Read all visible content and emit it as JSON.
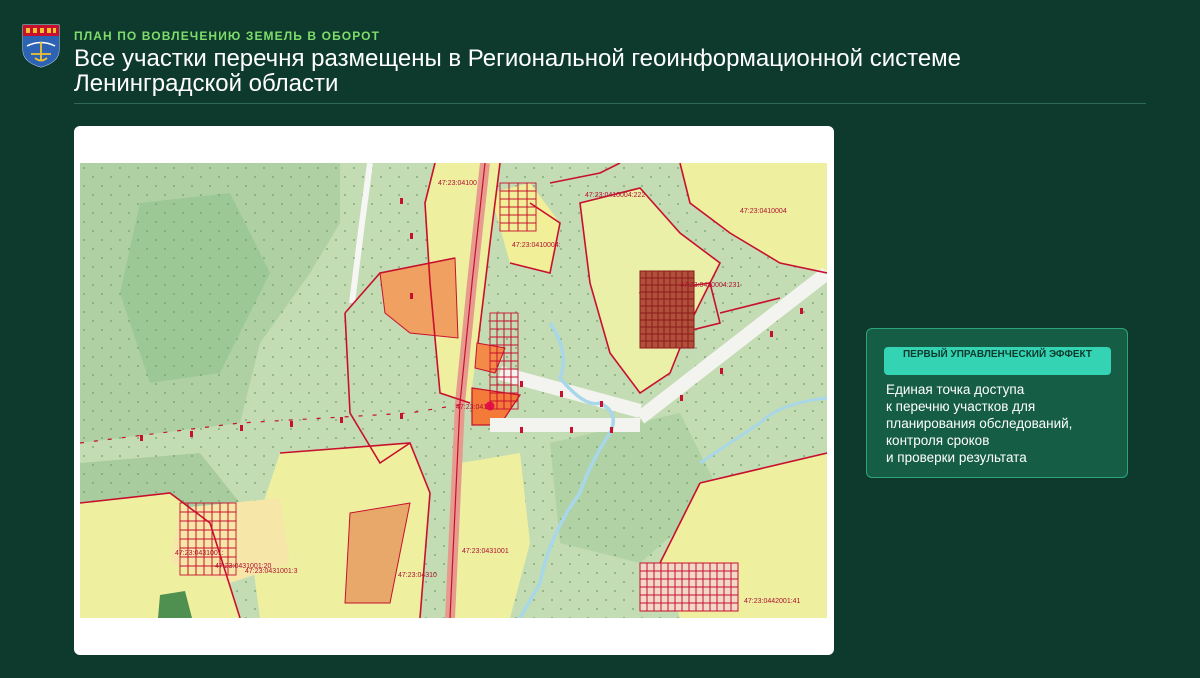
{
  "header": {
    "kicker": "ПЛАН ПО ВОВЛЕЧЕНИЮ ЗЕМЕЛЬ В ОБОРОТ",
    "title": "Все участки перечня размещены в Региональной геоинформационной системе Ленинградской области"
  },
  "map": {
    "parcel_labels": [
      "47:23:0410004:222",
      "47:23:0410004:231",
      "47:23:0410004:",
      "47:23:04100",
      "47:23:0410004",
      "47:23:0431001",
      "47:23:0431001:",
      "47:23:04310",
      "47:23:0431001:20",
      "47:23:0431001:3",
      "47:23:0442001:41",
      "47:23:041"
    ],
    "colors": {
      "forest": "#b9d7ab",
      "forest_dark": "#8fc08a",
      "field": "#eef0a0",
      "parcel_orange": "#f0a060",
      "parcel_selected": "#f47a3a",
      "boundary": "#c8102e",
      "road": "#f3f3f0",
      "river": "#a7d7e8"
    }
  },
  "effect": {
    "tag_label": "ПЕРВЫЙ УПРАВЛЕНЧЕСКИЙ ЭФФЕКТ",
    "lines": [
      "Единая точка доступа",
      "к перечню участков для",
      "планирования обследований,",
      "контроля сроков",
      "и проверки результата"
    ]
  }
}
